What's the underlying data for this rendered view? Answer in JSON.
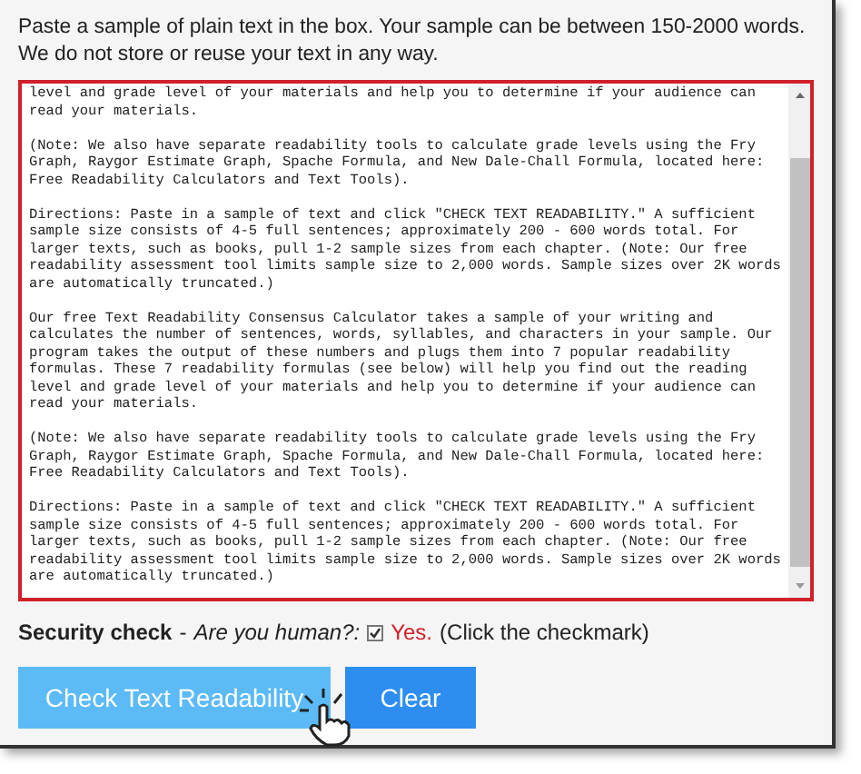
{
  "intro": "Paste a sample of plain text in the box. Your sample can be between 150-2000 words. We do not store or reuse your text in any way.",
  "sample_text": [
    "level and grade level of your materials and help you to determine if your audience can\nread your materials.",
    "(Note: We also have separate readability tools to calculate grade levels using the Fry\nGraph, Raygor Estimate Graph, Spache Formula, and New Dale-Chall Formula, located here:\nFree Readability Calculators and Text Tools).",
    "Directions: Paste in a sample of text and click \"CHECK TEXT READABILITY.\" A sufficient\nsample size consists of 4-5 full sentences; approximately 200 - 600 words total. For\nlarger texts, such as books, pull 1-2 sample sizes from each chapter. (Note: Our free\nreadability assessment tool limits sample size to 2,000 words. Sample sizes over 2K words\nare automatically truncated.)",
    "Our free Text Readability Consensus Calculator takes a sample of your writing and\ncalculates the number of sentences, words, syllables, and characters in your sample. Our\nprogram takes the output of these numbers and plugs them into 7 popular readability\nformulas. These 7 readability formulas (see below) will help you find out the reading\nlevel and grade level of your materials and help you to determine if your audience can\nread your materials.",
    "(Note: We also have separate readability tools to calculate grade levels using the Fry\nGraph, Raygor Estimate Graph, Spache Formula, and New Dale-Chall Formula, located here:\nFree Readability Calculators and Text Tools).",
    "Directions: Paste in a sample of text and click \"CHECK TEXT READABILITY.\" A sufficient\nsample size consists of 4-5 full sentences; approximately 200 - 600 words total. For\nlarger texts, such as books, pull 1-2 sample sizes from each chapter. (Note: Our free\nreadability assessment tool limits sample size to 2,000 words. Sample sizes over 2K words\nare automatically truncated.)"
  ],
  "security_check": {
    "label": "Security check",
    "separator": "-",
    "question": "Are you human?:",
    "checked": true,
    "answer": "Yes.",
    "hint": "(Click the checkmark)"
  },
  "buttons": [
    {
      "label": "Check Text Readability",
      "hovered": true
    },
    {
      "label": "Clear",
      "hovered": false
    }
  ]
}
